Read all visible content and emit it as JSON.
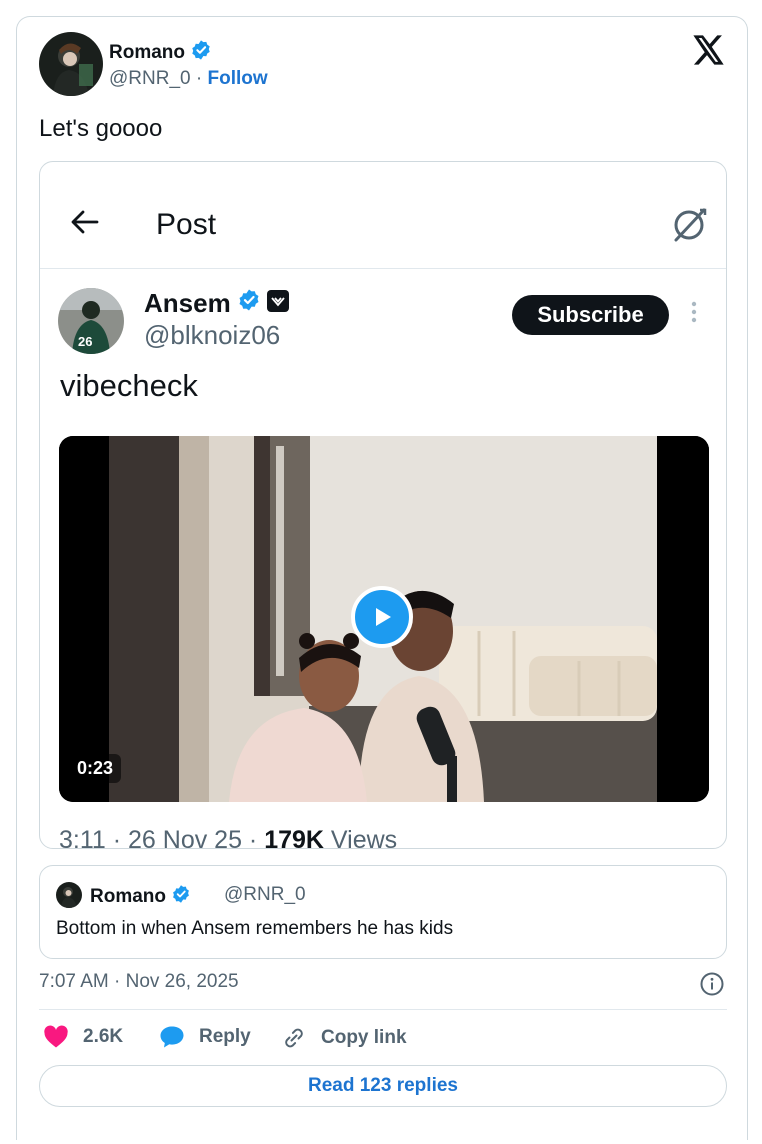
{
  "author": {
    "name": "Romano",
    "handle": "@RNR_0",
    "separator": "·",
    "follow_label": "Follow"
  },
  "tweet_text": "Let's goooo",
  "embedded_post": {
    "title": "Post",
    "author_name": "Ansem",
    "author_handle": "@blknoiz06",
    "avatar_jersey": "26",
    "subscribe_label": "Subscribe",
    "text": "vibecheck",
    "video_duration": "0:23",
    "meta_time": "3:11 · 26 Nov 25 · ",
    "meta_views_count": "179K",
    "meta_views_label": " Views"
  },
  "quoted": {
    "name": "Romano",
    "handle": "@RNR_0",
    "text": "Bottom in when Ansem remembers he has kids"
  },
  "timestamp": "7:07 AM · Nov 26, 2025",
  "actions": {
    "likes": "2.6K",
    "reply_label": "Reply",
    "copy_label": "Copy link"
  },
  "read_replies_label": "Read 123 replies",
  "colors": {
    "accent": "#1d9bf0",
    "link": "#1d74d0",
    "like": "#f91880",
    "text": "#0f1419",
    "muted": "#536471",
    "border": "#cfd9de"
  },
  "icons": [
    "verified-badge-icon",
    "x-logo-icon",
    "back-arrow-icon",
    "grok-icon",
    "more-dots-icon",
    "play-icon",
    "info-icon",
    "heart-icon",
    "reply-bubble-icon",
    "link-icon"
  ]
}
